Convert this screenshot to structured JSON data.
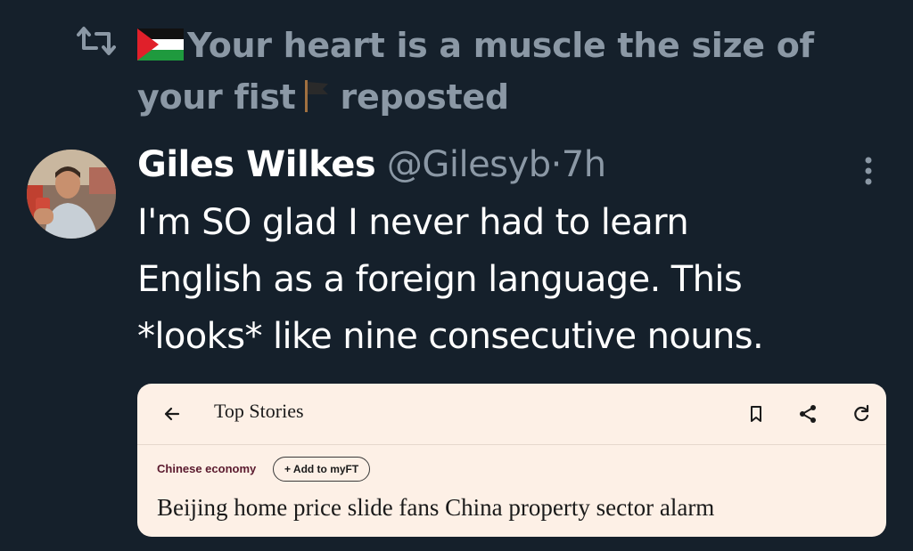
{
  "repost": {
    "line1": "Your heart is a muscle the size of",
    "line2_a": "your fist",
    "line2_b": "reposted"
  },
  "tweet": {
    "author_name": "Giles Wilkes",
    "handle": "@Gilesyb",
    "separator": "·",
    "time": "7h",
    "text_lines": [
      "I'm SO glad I never had to learn",
      "English as a foreign language. This",
      "*looks* like nine consecutive nouns."
    ]
  },
  "card": {
    "title": "Top Stories",
    "topic": "Chinese economy",
    "add_button": "+ Add to myFT",
    "headline": "Beijing home price slide fans China property sector alarm"
  },
  "colors": {
    "background": "#15202b",
    "muted_text": "#8b98a5",
    "card_background": "#fdf0e6",
    "topic_color": "#5a1a2e"
  }
}
